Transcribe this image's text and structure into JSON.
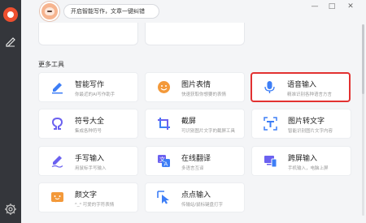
{
  "header": {
    "tip": "开启智能写作，文章一键纠错"
  },
  "window_controls": {
    "minimize": "—",
    "maximize": "□",
    "close": "✕"
  },
  "section": {
    "title": "更多工具"
  },
  "tools": [
    {
      "name": "智能写作",
      "desc": "你最近的AI写作助手",
      "icon": "ai-writing-icon",
      "selected": false
    },
    {
      "name": "图片表情",
      "desc": "快速获取你想要的表情",
      "icon": "emoji-icon",
      "selected": false
    },
    {
      "name": "语音输入",
      "desc": "精准识别各种语言方言",
      "icon": "microphone-icon",
      "selected": true
    },
    {
      "name": "符号大全",
      "desc": "集成各种符号",
      "icon": "omega-symbol-icon",
      "selected": false
    },
    {
      "name": "截屏",
      "desc": "可识别图片文字的截屏工具",
      "icon": "screenshot-icon",
      "selected": false
    },
    {
      "name": "图片转文字",
      "desc": "智能识别图片文字内容",
      "icon": "image-to-text-icon",
      "selected": false
    },
    {
      "name": "手写输入",
      "desc": "用鼠标手写输入",
      "icon": "handwriting-icon",
      "selected": false
    },
    {
      "name": "在线翻译",
      "desc": "多语言互译",
      "icon": "translate-icon",
      "selected": false
    },
    {
      "name": "跨屏输入",
      "desc": "手机输入，电脑上屏",
      "icon": "cross-screen-icon",
      "selected": false
    },
    {
      "name": "颜文字",
      "desc": "^_^ 可爱的字符表情",
      "icon": "kaomoji-icon",
      "selected": false
    },
    {
      "name": "点点输入",
      "desc": "传输站/鼠标键盘打字",
      "icon": "pointer-input-icon",
      "selected": false
    }
  ],
  "colors": {
    "accent_blue": "#3d7ef6",
    "accent_purple": "#6b61f0",
    "accent_orange": "#f3993a",
    "selection_red": "#e23131",
    "brand_red": "#ee4f2f"
  }
}
